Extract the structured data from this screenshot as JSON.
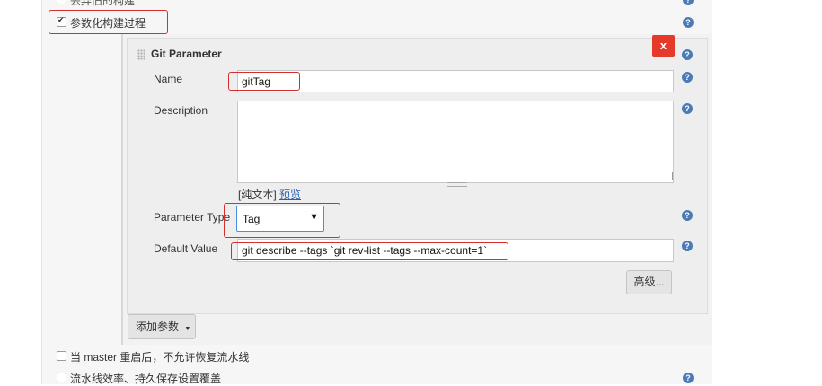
{
  "top_partial_label": "丢弃旧的构建",
  "param_build": {
    "label": "参数化构建过程",
    "checked": true
  },
  "git_param": {
    "title": "Git Parameter",
    "close_label": "x",
    "name_label": "Name",
    "name_value": "gitTag",
    "description_label": "Description",
    "description_value": "",
    "plain_text": "[纯文本]",
    "preview_link": "预览",
    "param_type_label": "Parameter Type",
    "param_type_value": "Tag",
    "default_value_label": "Default Value",
    "default_value": "git describe --tags `git rev-list --tags --max-count=1`",
    "advanced_button": "高级..."
  },
  "add_param_button": "添加参数",
  "options": [
    {
      "label": "当 master 重启后，不允许恢复流水线",
      "checked": false
    },
    {
      "label": "流水线效率、持久保存设置覆盖",
      "checked": false
    }
  ],
  "help_glyph": "?",
  "colors": {
    "highlight": "#d32f2f",
    "close": "#e53a2a",
    "help": "#4a7bb7",
    "link": "#2a5db0"
  }
}
